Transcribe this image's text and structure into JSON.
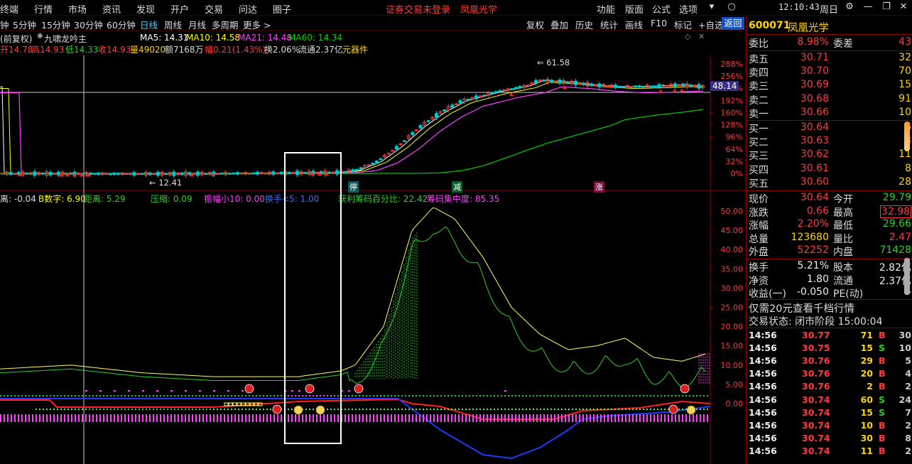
{
  "menu": {
    "items": [
      "终端",
      "行情",
      "市场",
      "资讯",
      "发现",
      "开户",
      "交易",
      "问达",
      "圈子"
    ],
    "title_left": "证券交易未登录",
    "title_right": "凤凰光学",
    "right_items": [
      "功能",
      "版面",
      "公式",
      "选项"
    ],
    "clock": "12:10:43",
    "weekday": "周日"
  },
  "periods": [
    "钟",
    "5分钟",
    "15分钟",
    "30分钟",
    "60分钟",
    "日线",
    "周线",
    "月线",
    "多周期",
    "更多 >"
  ],
  "active_period": "日线",
  "tools": [
    "复权",
    "叠加",
    "历史",
    "统计",
    "画线",
    "F10",
    "标记",
    "+自选"
  ],
  "return_label": "返回",
  "main_header": {
    "fq": "前复权",
    "indicator": "九啸龙吟主",
    "ma5": "MA5: 14.31",
    "ma10": "MA10: 14.58",
    "ma21": "MA21: 14.48",
    "ma60": "MA60: 14.34",
    "open": "开14.78",
    "high": "高14.93",
    "low": "低14.33",
    "close": "收14.93",
    "vol": "量49020",
    "amount": "额7168万",
    "change": "幅0.21(1.43%)",
    "turnover": "换2.06%",
    "float": "流通2.37亿",
    "sector": "元器件"
  },
  "main_chart": {
    "y_ticks": [
      "288%",
      "256%",
      "224%",
      "192%",
      "160%",
      "128%",
      "96%",
      "64%",
      "32%",
      "0%"
    ],
    "high_label": "61.58",
    "low_label": "12.41",
    "price_tag": "48.14",
    "markers": [
      "停",
      "减",
      "涨"
    ]
  },
  "sub_header": {
    "a": "离: -0.04",
    "b": "B数字: 6.90",
    "c": "距离: 5.29",
    "d": "压缩: 0.09",
    "e": "振幅小10: 0.00",
    "f": "换手<5: 1.00",
    "g": "获利筹码百分比: 22.42",
    "h": "筹码集中度: 85.35"
  },
  "sub_chart": {
    "y_ticks": [
      "50.00",
      "45.00",
      "40.00",
      "35.00",
      "30.00",
      "25.00",
      "20.00",
      "15.00",
      "10.00",
      "5.00",
      "0.00"
    ]
  },
  "quote": {
    "code": "600071",
    "name": "凤凰光学",
    "weibi_label": "委比",
    "weibi": "8.98%",
    "weicha_label": "委差",
    "weicha": "43",
    "asks": [
      {
        "label": "卖五",
        "price": "30.71",
        "vol": "32"
      },
      {
        "label": "卖四",
        "price": "30.70",
        "vol": "70"
      },
      {
        "label": "卖三",
        "price": "30.69",
        "vol": "15"
      },
      {
        "label": "卖二",
        "price": "30.68",
        "vol": "91"
      },
      {
        "label": "卖一",
        "price": "30.66",
        "vol": "10"
      }
    ],
    "bids": [
      {
        "label": "买一",
        "price": "30.64",
        "vol": "6"
      },
      {
        "label": "买二",
        "price": "30.63",
        "vol": "3"
      },
      {
        "label": "买三",
        "price": "30.62",
        "vol": "11"
      },
      {
        "label": "买四",
        "price": "30.61",
        "vol": "8"
      },
      {
        "label": "买五",
        "price": "30.60",
        "vol": "28"
      }
    ],
    "stats": [
      {
        "l1": "现价",
        "v1": "30.64",
        "c1": "red",
        "l2": "今开",
        "v2": "29.79",
        "c2": "green"
      },
      {
        "l1": "涨跌",
        "v1": "0.66",
        "c1": "red",
        "l2": "最高",
        "v2": "32.98",
        "c2": "red"
      },
      {
        "l1": "涨幅",
        "v1": "2.20%",
        "c1": "red",
        "l2": "最低",
        "v2": "29.66",
        "c2": "green"
      },
      {
        "l1": "总量",
        "v1": "123680",
        "c1": "yellow",
        "l2": "量比",
        "v2": "2.47",
        "c2": "red"
      },
      {
        "l1": "外盘",
        "v1": "52252",
        "c1": "red",
        "l2": "内盘",
        "v2": "71428",
        "c2": "green"
      }
    ],
    "stats2": [
      {
        "l1": "换手",
        "v1": "5.21%",
        "c1": "white",
        "l2": "股本",
        "v2": "2.82亿",
        "c2": "white"
      },
      {
        "l1": "净资",
        "v1": "1.80",
        "c1": "white",
        "l2": "流通",
        "v2": "2.37亿",
        "c2": "white"
      },
      {
        "l1": "收益(一)",
        "v1": "-0.050",
        "c1": "white",
        "l2": "PE(动)",
        "v2": "-",
        "c2": "white"
      }
    ],
    "promo": "仅需20元查看千档行情",
    "status": "交易状态: 闭市阶段 15:00:04",
    "ticks": [
      {
        "time": "14:56",
        "price": "30.77",
        "vol": "71",
        "side": "B",
        "n": "30"
      },
      {
        "time": "14:56",
        "price": "30.75",
        "vol": "15",
        "side": "S",
        "n": "10"
      },
      {
        "time": "14:56",
        "price": "30.76",
        "vol": "29",
        "side": "B",
        "n": "5"
      },
      {
        "time": "14:56",
        "price": "30.76",
        "vol": "20",
        "side": "B",
        "n": "4"
      },
      {
        "time": "14:56",
        "price": "30.76",
        "vol": "2",
        "side": "B",
        "n": "2"
      },
      {
        "time": "14:56",
        "price": "30.74",
        "vol": "60",
        "side": "S",
        "n": "24"
      },
      {
        "time": "14:56",
        "price": "30.74",
        "vol": "15",
        "side": "S",
        "n": "7"
      },
      {
        "time": "14:56",
        "price": "30.74",
        "vol": "10",
        "side": "B",
        "n": "2"
      },
      {
        "time": "14:56",
        "price": "30.74",
        "vol": "30",
        "side": "B",
        "n": "8"
      },
      {
        "time": "14:56",
        "price": "30.74",
        "vol": "11",
        "side": "B",
        "n": "2"
      }
    ]
  },
  "colors": {
    "up": "#ff3b3b",
    "down": "#27d227",
    "ma5": "#ffffff",
    "ma10": "#ffff00",
    "ma21": "#ff40ff",
    "ma60": "#00d000",
    "accent": "#1452c0"
  }
}
